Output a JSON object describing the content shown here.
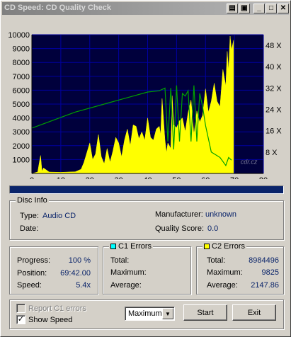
{
  "window": {
    "title": "CD Speed: CD Quality Check"
  },
  "titlebar_buttons": [
    {
      "name": "copy-icon",
      "glyph": "▤"
    },
    {
      "name": "save-icon",
      "glyph": "▣"
    },
    {
      "name": "minimize-button",
      "glyph": "_"
    },
    {
      "name": "maximize-button",
      "glyph": "□"
    },
    {
      "name": "close-button",
      "glyph": "✕"
    }
  ],
  "chart_data": {
    "type": "area",
    "colors": {
      "background": "#00003c",
      "grid": "#0000a0",
      "c2": "#ffff00",
      "speed": "#00a000"
    },
    "x_ticks": [
      0,
      10,
      20,
      30,
      40,
      50,
      60,
      70,
      80
    ],
    "y_left_ticks": [
      1000,
      2000,
      3000,
      4000,
      5000,
      6000,
      7000,
      8000,
      9000,
      10000
    ],
    "y_right_ticks": [
      "8 X",
      "16 X",
      "24 X",
      "32 X",
      "40 X",
      "48 X"
    ],
    "xlim": [
      0,
      80
    ],
    "ylim_left": [
      0,
      10000
    ],
    "ylim_right": [
      0,
      52
    ],
    "watermark": "cdr.cz",
    "series": [
      {
        "kind": "c2-errors",
        "color": "#ffff00",
        "x": [
          0,
          2,
          3,
          3.5,
          4,
          6,
          10,
          15,
          17,
          18,
          19,
          20,
          21,
          22,
          23,
          24,
          25,
          26,
          27,
          28,
          29,
          30,
          31,
          32,
          33,
          34,
          35,
          36,
          37,
          38,
          39,
          40,
          41,
          42,
          43,
          44,
          44.5,
          45,
          46,
          46.5,
          47,
          48,
          48.5,
          49,
          50,
          51,
          52,
          53,
          54,
          55,
          56,
          57,
          58,
          59,
          60,
          61,
          62,
          63,
          64,
          65,
          66,
          67,
          67.5,
          68,
          68.5,
          69,
          69.7,
          69.7
        ],
        "values": [
          0,
          100,
          1300,
          150,
          400,
          100,
          80,
          120,
          300,
          800,
          1500,
          2200,
          1000,
          1400,
          2800,
          1200,
          700,
          1800,
          800,
          1600,
          2600,
          2200,
          1200,
          2400,
          3200,
          2000,
          3500,
          3400,
          2500,
          3000,
          2400,
          4000,
          2600,
          2400,
          3200,
          3400,
          2800,
          5400,
          2400,
          1500,
          2200,
          1800,
          5600,
          3500,
          3300,
          3800,
          4000,
          3000,
          4400,
          5300,
          2800,
          4500,
          3700,
          4200,
          6100,
          4400,
          5200,
          6500,
          5200,
          4800,
          7500,
          6300,
          8800,
          7400,
          9900,
          8900,
          9600,
          0
        ]
      },
      {
        "kind": "read-speed",
        "color": "#00a000",
        "x": [
          0,
          5,
          10,
          15,
          20,
          25,
          30,
          35,
          40,
          44,
          46,
          47,
          48,
          49,
          50,
          51,
          52,
          53,
          54,
          55,
          56,
          57,
          58,
          59,
          60,
          62,
          65,
          67,
          68,
          69
        ],
        "values": [
          17,
          19,
          21,
          23,
          24.5,
          26,
          27.5,
          29,
          30.5,
          31,
          32,
          12,
          32,
          9,
          33,
          12,
          30,
          29,
          31,
          12,
          33,
          12,
          30,
          25,
          18,
          8,
          6,
          3,
          6,
          5
        ]
      }
    ]
  },
  "progress_bar": {
    "fraction": 1.0
  },
  "disc_info": {
    "title": "Disc Info",
    "type_label": "Type:",
    "type_value": "Audio CD",
    "date_label": "Date:",
    "manufacturer_label": "Manufacturer:",
    "manufacturer_value": "unknown",
    "quality_label": "Quality Score:",
    "quality_value": "0.0"
  },
  "stats": {
    "progress_label": "Progress:",
    "progress_value": "100 %",
    "position_label": "Position:",
    "position_value": "69:42.00",
    "speed_label": "Speed:",
    "speed_value": "5.4x"
  },
  "c1": {
    "title": "C1 Errors",
    "color": "#00ffff",
    "total_label": "Total:",
    "maximum_label": "Maximum:",
    "average_label": "Average:"
  },
  "c2": {
    "title": "C2 Errors",
    "color": "#ffff00",
    "total_label": "Total:",
    "total_value": "8984496",
    "maximum_label": "Maximum:",
    "maximum_value": "9825",
    "average_label": "Average:",
    "average_value": "2147.86"
  },
  "options": {
    "report_c1_label": "Report C1 errors",
    "report_c1_checked": false,
    "show_speed_label": "Show Speed",
    "show_speed_checked": true
  },
  "controls": {
    "mode_select_value": "Maximum",
    "start_label": "Start",
    "exit_label": "Exit"
  }
}
